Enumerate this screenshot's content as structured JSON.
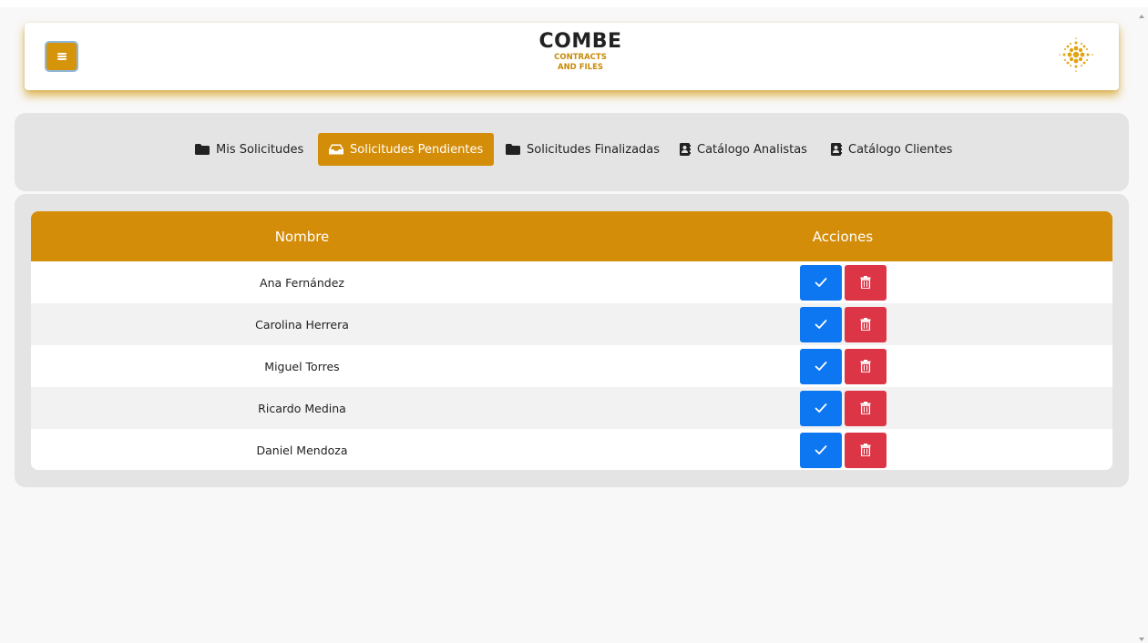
{
  "header": {
    "logo_title": "COMBE",
    "logo_line2": "CONTRACTS",
    "logo_line3": "AND FILES",
    "menu_icon": "hamburger-icon",
    "brand_color": "#d48d08"
  },
  "nav": {
    "tabs": [
      {
        "label": "Mis Solicitudes",
        "icon": "folder-icon",
        "active": false
      },
      {
        "label": "Solicitudes Pendientes",
        "icon": "inbox-icon",
        "active": true
      },
      {
        "label": "Solicitudes Finalizadas",
        "icon": "folder-icon",
        "active": false
      },
      {
        "label": "Catálogo Analistas",
        "icon": "address-book-icon",
        "active": false
      },
      {
        "label": "Catálogo Clientes",
        "icon": "address-book-icon",
        "active": false
      }
    ]
  },
  "table": {
    "headers": [
      "Nombre",
      "Acciones"
    ],
    "rows": [
      {
        "name": "Ana Fernández"
      },
      {
        "name": "Carolina Herrera"
      },
      {
        "name": "Miguel Torres"
      },
      {
        "name": "Ricardo Medina"
      },
      {
        "name": "Daniel Mendoza"
      }
    ],
    "approve_icon": "check-icon",
    "delete_icon": "trash-icon",
    "approve_color": "#0d76f1",
    "delete_color": "#dc3546"
  }
}
